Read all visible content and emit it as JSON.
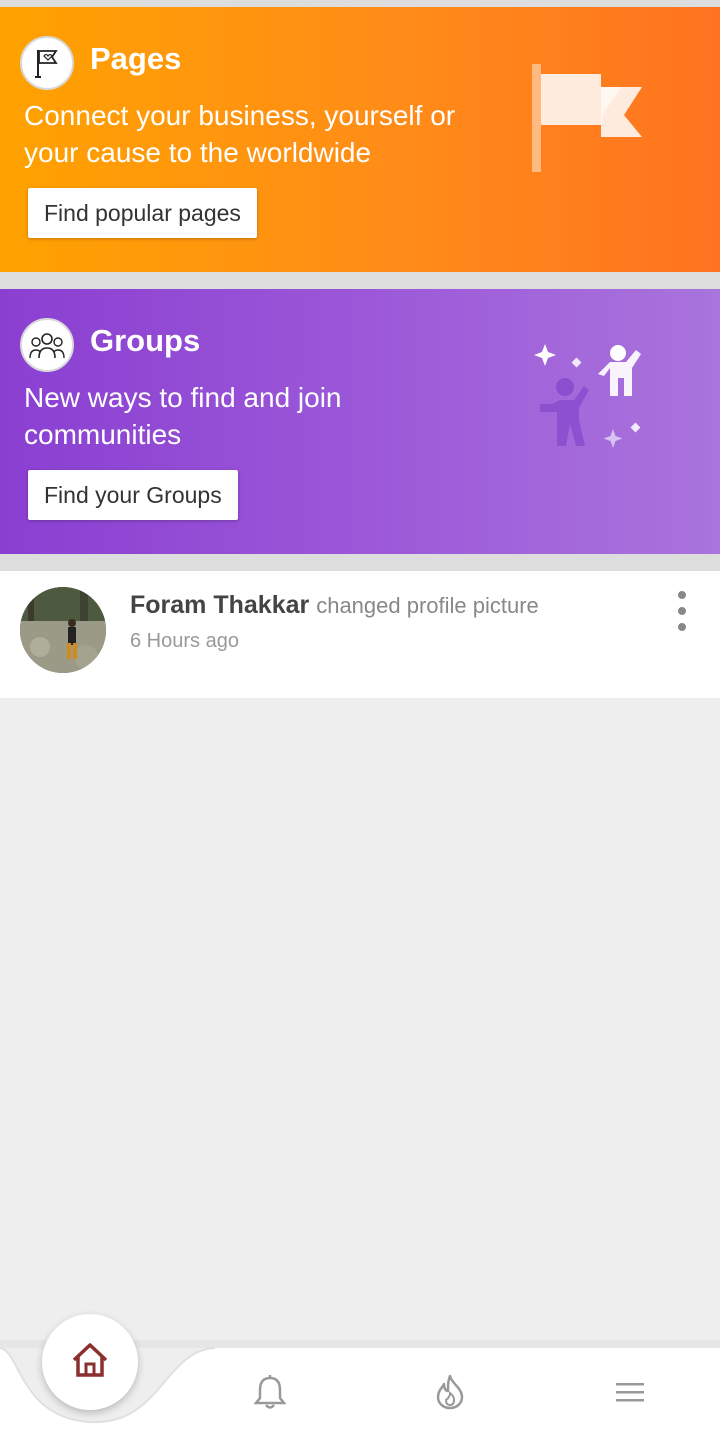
{
  "pages_card": {
    "title": "Pages",
    "description": "Connect your business, yourself or your cause to the worldwide",
    "button_label": "Find popular pages",
    "icon": "flag-icon",
    "illustration": "flag-illustration",
    "colors": {
      "start": "#ffa200",
      "end": "#ff7320"
    }
  },
  "groups_card": {
    "title": "Groups",
    "description": "New ways to find and join communities",
    "button_label": "Find your Groups",
    "icon": "people-icon",
    "illustration": "high-five-illustration",
    "colors": {
      "start": "#8a3fd1",
      "end": "#a974dc"
    }
  },
  "activity": {
    "user_name": "Foram Thakkar",
    "action": "changed profile picture",
    "time": "6 Hours ago",
    "avatar": "profile-avatar",
    "menu_icon": "more-vertical-icon"
  },
  "bottom_nav": {
    "items": [
      {
        "name": "home",
        "icon": "home-icon",
        "active": true,
        "color": "#8b2e2e"
      },
      {
        "name": "notifications",
        "icon": "bell-icon",
        "active": false
      },
      {
        "name": "trending",
        "icon": "fire-icon",
        "active": false
      },
      {
        "name": "menu",
        "icon": "hamburger-menu-icon",
        "active": false
      }
    ]
  }
}
